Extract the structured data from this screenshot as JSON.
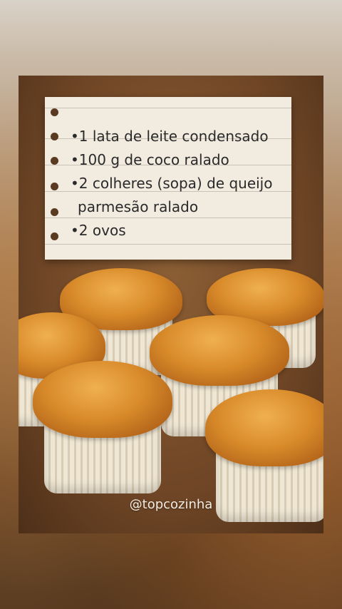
{
  "recipe_note": {
    "lines": [
      "•1 lata de leite condensado",
      "•100 g de coco ralado",
      "•2 colheres (sopa) de queijo",
      "parmesão ralado",
      "•2 ovos"
    ]
  },
  "watermark": {
    "handle": "@topcozinha"
  },
  "colors": {
    "paper": "#f1ebe0",
    "muffin_top": "#d98b2a",
    "paper_cup": "#efe6d4"
  }
}
